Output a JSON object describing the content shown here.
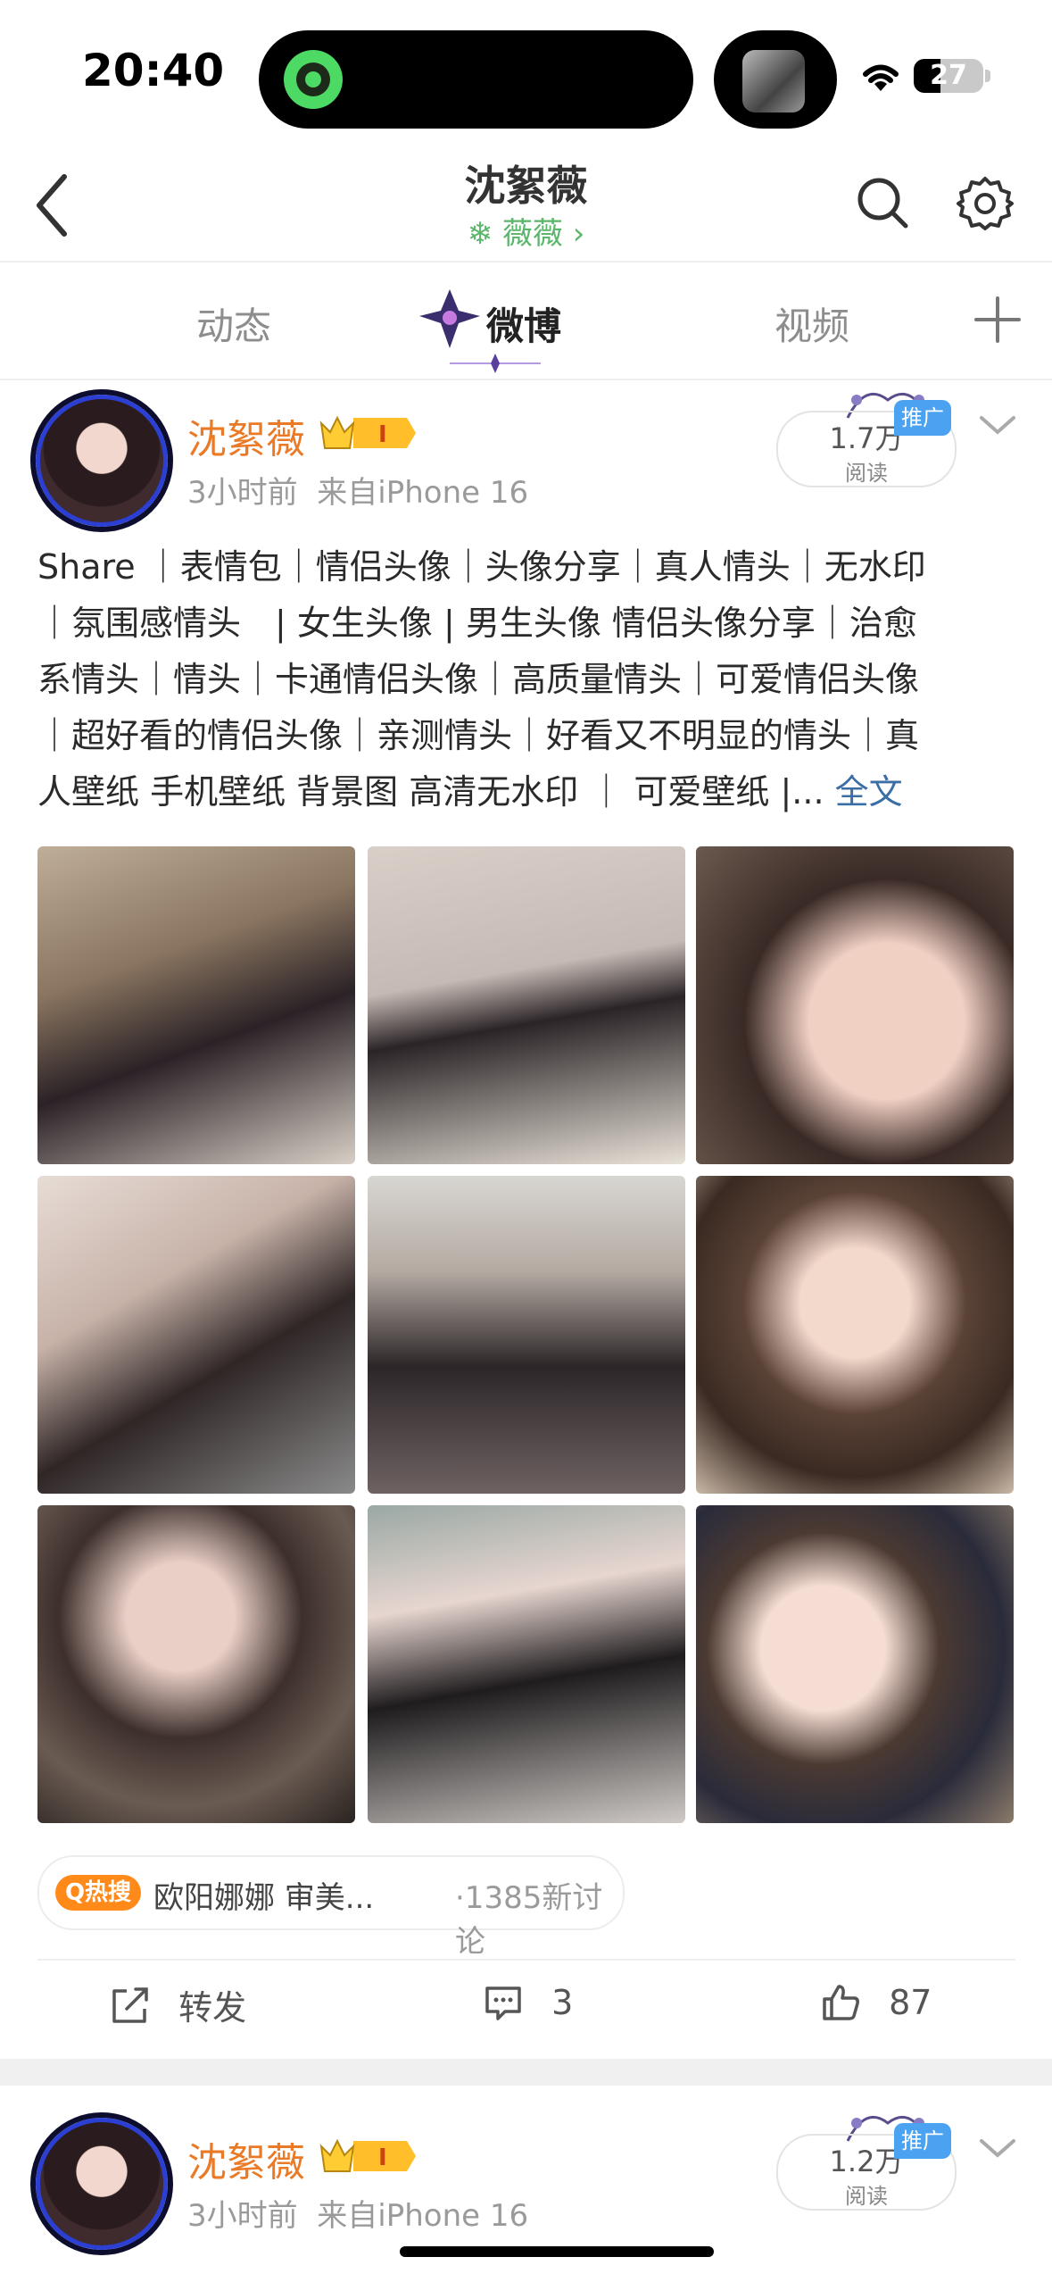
{
  "status": {
    "time": "20:40",
    "battery": "27"
  },
  "nav": {
    "title": "沈絮薇",
    "subtitle": "薇薇 ›"
  },
  "tabs": [
    {
      "label": "动态"
    },
    {
      "label": "微博"
    },
    {
      "label": "视频"
    }
  ],
  "posts": [
    {
      "username": "沈絮薇",
      "vip_level": "I",
      "time": "3小时前",
      "source": "来自iPhone 16",
      "reads": "1.7万",
      "reads_label": "阅读",
      "promo": "推广",
      "text_lines": [
        "Share ｜表情包｜情侣头像｜头像分享｜真人情头｜无水印",
        "｜氛围感情头　| 女生头像 | 男生头像  情侣头像分享｜治愈",
        "系情头｜情头｜卡通情侣头像｜高质量情头｜可爱情侣头像",
        "｜超好看的情侣头像｜亲测情头｜好看又不明显的情头｜真",
        "人壁纸 手机壁纸  背景图 高清无水印 ｜   可爱壁纸 |..."
      ],
      "full_text_label": "全文",
      "hot_badge": "Q热搜",
      "hot_topic": "欧阳娜娜 审美...",
      "hot_count": "·1385新讨论",
      "actions": {
        "repost": "转发",
        "comments": "3",
        "likes": "87"
      }
    },
    {
      "username": "沈絮薇",
      "vip_level": "I",
      "time": "3小时前",
      "source": "来自iPhone 16",
      "reads": "1.2万",
      "reads_label": "阅读",
      "promo": "推广"
    }
  ],
  "colors": {
    "username": "#eb7a26",
    "accent_link": "#3b6ea6",
    "hot_badge": "#ff8a1a",
    "promo": "#4aa2f0",
    "nav_sub": "#5bb56b"
  }
}
